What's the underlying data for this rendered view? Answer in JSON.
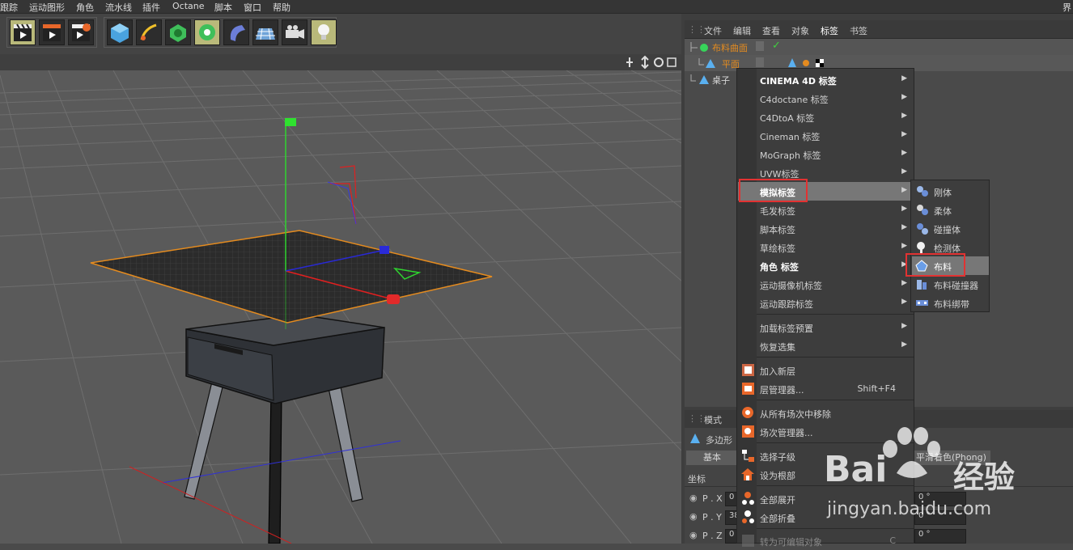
{
  "menubar": {
    "items": [
      "跟踪",
      "运动图形",
      "角色",
      "流水线",
      "插件",
      "Octane",
      "脚本",
      "窗口",
      "帮助"
    ],
    "right_label": "界"
  },
  "object_manager": {
    "tabs": [
      "文件",
      "编辑",
      "查看",
      "对象",
      "标签",
      "书签"
    ],
    "objects": [
      {
        "name": "布料曲面"
      },
      {
        "name": "平面"
      },
      {
        "name": "桌子"
      }
    ]
  },
  "attribute_manager": {
    "tabs": [
      "模式"
    ],
    "object_label": "多边形",
    "basic_tab": "基本",
    "coord_tab": "坐标",
    "phong_tab": "平滑着色(Phong)",
    "rows": [
      {
        "label": "P . X",
        "value": "0",
        "right": "0 °"
      },
      {
        "label": "P . Y",
        "value": "38",
        "right": "0 °"
      },
      {
        "label": "P . Z",
        "value": "0",
        "right": "0 °"
      }
    ]
  },
  "context_menu": {
    "items": [
      {
        "label": "CINEMA 4D 标签",
        "submenu": true
      },
      {
        "label": "C4doctane 标签",
        "submenu": true
      },
      {
        "label": "C4DtoA 标签",
        "submenu": true
      },
      {
        "label": "Cineman 标签",
        "submenu": true
      },
      {
        "label": "MoGraph 标签",
        "submenu": true
      },
      {
        "label": "UVW标签",
        "submenu": true
      },
      {
        "label": "模拟标签",
        "submenu": true
      },
      {
        "label": "毛发标签",
        "submenu": true
      },
      {
        "label": "脚本标签",
        "submenu": true
      },
      {
        "label": "草绘标签",
        "submenu": true
      },
      {
        "label": "角色 标签",
        "submenu": true
      },
      {
        "label": "运动摄像机标签",
        "submenu": true
      },
      {
        "label": "运动跟踪标签",
        "submenu": true
      },
      {
        "label": "加载标签预置",
        "submenu": true
      },
      {
        "label": "恢复选集",
        "submenu": true
      },
      {
        "label": "加入新层"
      },
      {
        "label": "层管理器...",
        "shortcut": "Shift+F4"
      },
      {
        "label": "从所有场次中移除"
      },
      {
        "label": "场次管理器..."
      },
      {
        "label": "选择子级"
      },
      {
        "label": "设为根部"
      },
      {
        "label": "全部展开"
      },
      {
        "label": "全部折叠"
      },
      {
        "label": "转为可编辑对象",
        "shortcut": "C"
      }
    ]
  },
  "submenu": {
    "items": [
      {
        "label": "刚体"
      },
      {
        "label": "柔体"
      },
      {
        "label": "碰撞体"
      },
      {
        "label": "检测体"
      },
      {
        "label": "布料"
      },
      {
        "label": "布料碰撞器"
      },
      {
        "label": "布料绑带"
      }
    ]
  },
  "watermark": {
    "brand": "Bai",
    "brand2": "经验",
    "url": "jingyan.baidu.com"
  }
}
